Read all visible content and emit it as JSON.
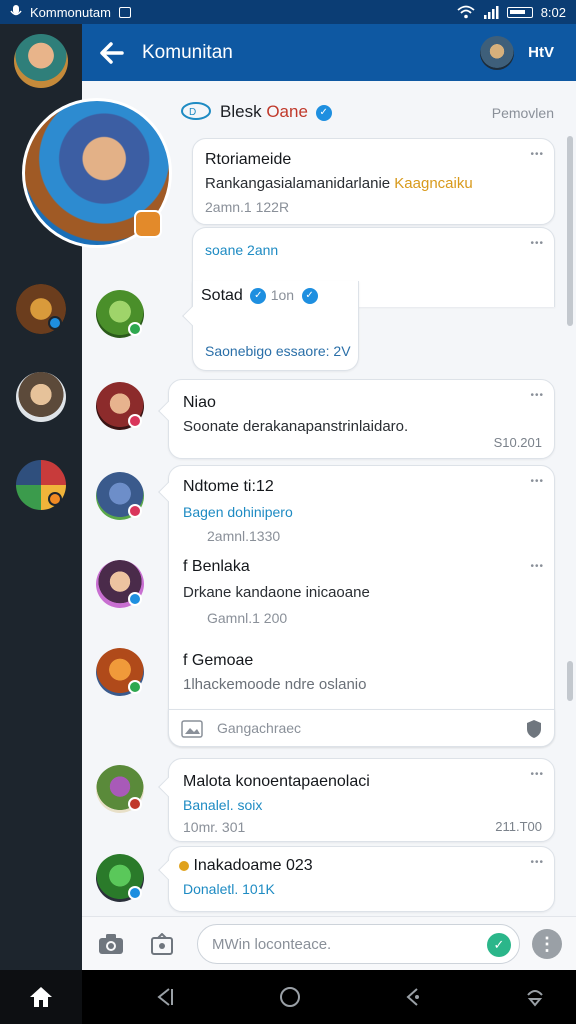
{
  "status_bar": {
    "carrier": "Kommonutam",
    "time": "8:02"
  },
  "header": {
    "title": "Komunitan",
    "right_label": "HtV"
  },
  "top_post": {
    "name": "Blesk",
    "tag": "Oane",
    "action": "Pemovlen"
  },
  "messages": [
    {
      "name": "Rtoriameide",
      "text": "Rankangasialamanidarlanie",
      "highlight": "Kaagncaiku",
      "meta": "2amn.1 122R"
    },
    {
      "link": "soane 2ann",
      "name": "Sotad",
      "tag": "1on",
      "sub": "Saonebigo essaore: 2V"
    },
    {
      "name": "Niao",
      "text": "Soonate derakanapanstrinlaidaro.",
      "time": "S10.201"
    },
    {
      "name": "Ndtome ti:12",
      "link": "Bagen dohinipero",
      "meta": "2amnl.1330"
    },
    {
      "name": "f Benlaka",
      "text": "Drkane kandaone inicaoane",
      "meta": "Gamnl.1 200"
    },
    {
      "name": "f Gemoae",
      "text": "1lhackemoode ndre oslanio",
      "action": "Gangachraec"
    },
    {
      "name": "Malota konoentapaenolaci",
      "link": "Banalel. soix",
      "meta": "10mr. 301",
      "time": "211.T00"
    },
    {
      "name": "Inakadoame 023",
      "link": "Donaletl. 101K"
    }
  ],
  "composer": {
    "placeholder": "MWin loconteace."
  },
  "icons": [
    "back-arrow-icon",
    "verified-icon",
    "camera-icon",
    "gallery-icon",
    "send-icon",
    "more-icon",
    "home-icon",
    "nav-back-icon",
    "nav-home-icon",
    "nav-recents-icon"
  ],
  "colors": {
    "header": "#0e58a2",
    "status_bar": "#0b3d74",
    "rail": "#1d252d",
    "accent": "#1e8fe0",
    "link": "#1e8bc3"
  }
}
